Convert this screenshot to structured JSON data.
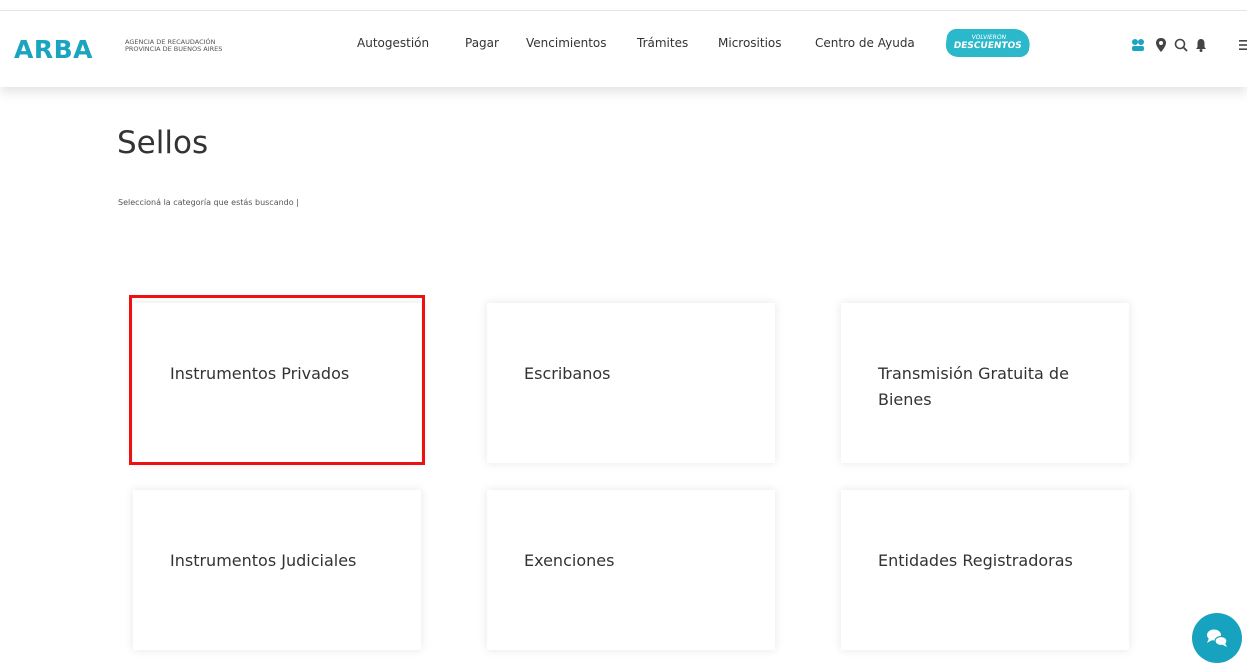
{
  "header": {
    "logo": "ARBA",
    "agency_line1": "AGENCIA DE RECAUDACIÓN",
    "agency_line2": "PROVINCIA DE BUENOS AIRES",
    "nav": [
      "Autogestión",
      "Pagar",
      "Vencimientos",
      "Trámites",
      "Micrositios",
      "Centro de Ayuda"
    ],
    "promo": {
      "line1": "VOLVIERON",
      "line2": "DESCUENTOS"
    },
    "icons": [
      "accessibility-icon",
      "location-pin-icon",
      "search-icon",
      "bell-icon",
      "menu-icon"
    ]
  },
  "page": {
    "title": "Sellos",
    "subtitle": "Seleccioná la categoría que estás buscando |"
  },
  "cards": [
    {
      "label": "Instrumentos Privados",
      "highlighted": true
    },
    {
      "label": "Escribanos",
      "highlighted": false
    },
    {
      "label": "Transmisión Gratuita de Bienes",
      "highlighted": false
    },
    {
      "label": "Instrumentos Judiciales",
      "highlighted": false
    },
    {
      "label": "Exenciones",
      "highlighted": false
    },
    {
      "label": "Entidades Registradoras",
      "highlighted": false
    }
  ],
  "colors": {
    "brand": "#1aa4bf",
    "promo": "#2bb8cb",
    "highlight": "#ee1111",
    "chat": "#17a2bf"
  },
  "chat_icon": "chat-bubbles-icon"
}
